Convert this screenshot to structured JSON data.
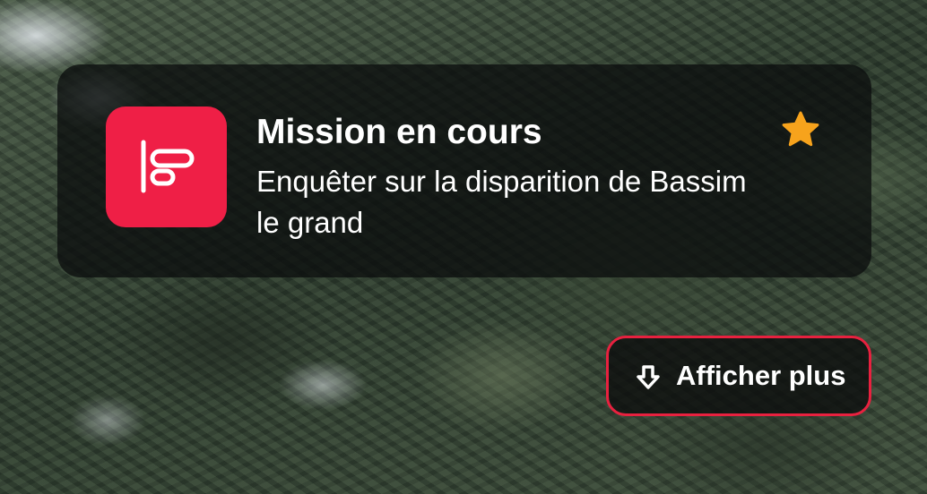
{
  "notification": {
    "app_icon": "mission-app-icon",
    "title": "Mission en cours",
    "body": "Enquêter sur la disparition de Bassim le grand",
    "favorite_icon": "star-icon"
  },
  "actions": {
    "more_label": "Afficher plus",
    "more_icon": "arrow-down-icon"
  },
  "colors": {
    "accent": "#ef1f46",
    "star": "#f7a31c",
    "card_background": "#0c0e0e",
    "text": "#ffffff"
  }
}
